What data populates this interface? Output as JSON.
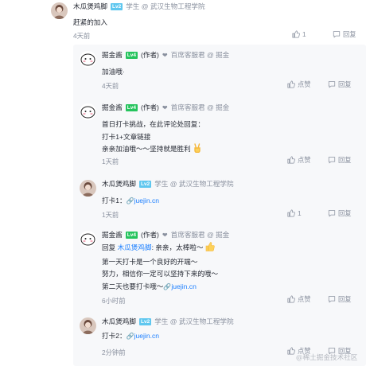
{
  "root": {
    "user": "木瓜煲鸡脚",
    "level": "Lv2",
    "role": "学生 @ 武汉生物工程学院",
    "text": "赶紧的加入",
    "time": "4天前",
    "likes": "1",
    "reply_label": "回复"
  },
  "replies": [
    {
      "user": "掘金酱",
      "level": "Lv4",
      "author_tag": "(作者)",
      "role": "百席客服君 @ 掘金",
      "lines": [
        "加油哦·"
      ],
      "time": "4天前",
      "like_label": "点赞",
      "reply_label": "回复"
    },
    {
      "user": "掘金酱",
      "level": "Lv4",
      "author_tag": "(作者)",
      "role": "首席客服君 @ 掘金",
      "lines": [
        "首日打卡挑战，在此评论处回复：",
        "打卡1+文章链接",
        "亲亲加油哦～～坚持就是胜利"
      ],
      "time": "1天前",
      "like_label": "点赞",
      "reply_label": "回复"
    },
    {
      "user": "木瓜煲鸡脚",
      "level": "Lv2",
      "role": "学生 @ 武汉生物工程学院",
      "prefix": "打卡1：",
      "link": "juejin.cn",
      "time": "1天前",
      "likes": "1",
      "reply_label": "回复"
    },
    {
      "user": "掘金酱",
      "level": "Lv4",
      "author_tag": "(作者)",
      "role": "首席客服君 @ 掘金",
      "reply_to_prefix": "回复 ",
      "reply_to_user": "木瓜煲鸡脚",
      "reply_to_text": ": 亲亲，太棒啦～",
      "line2": "第一天打卡是一个良好的开端～",
      "line3": "努力，相信你一定可以坚持下来的哦～",
      "line4_prefix": "第二天也要打卡哦～",
      "link": "juejin.cn",
      "time": "6小时前",
      "like_label": "点赞",
      "reply_label": "回复"
    },
    {
      "user": "木瓜煲鸡脚",
      "level": "Lv2",
      "role": "学生 @ 武汉生物工程学院",
      "prefix": "打卡2：",
      "link": "juejin.cn",
      "time": "2分钟前",
      "like_label": "点赞",
      "reply_label": "回复"
    }
  ],
  "watermark": "@稀土掘金技术社区",
  "colors": {
    "link": "#1e80ff",
    "lv2": "#5fc7ef",
    "lv4": "#25c45d",
    "meta": "#8a919f",
    "panel": "#f7f8fa"
  },
  "icons": {
    "like": "thumbs-up-icon",
    "reply": "comment-icon",
    "link": "link-icon",
    "heart": "heart-icon"
  }
}
